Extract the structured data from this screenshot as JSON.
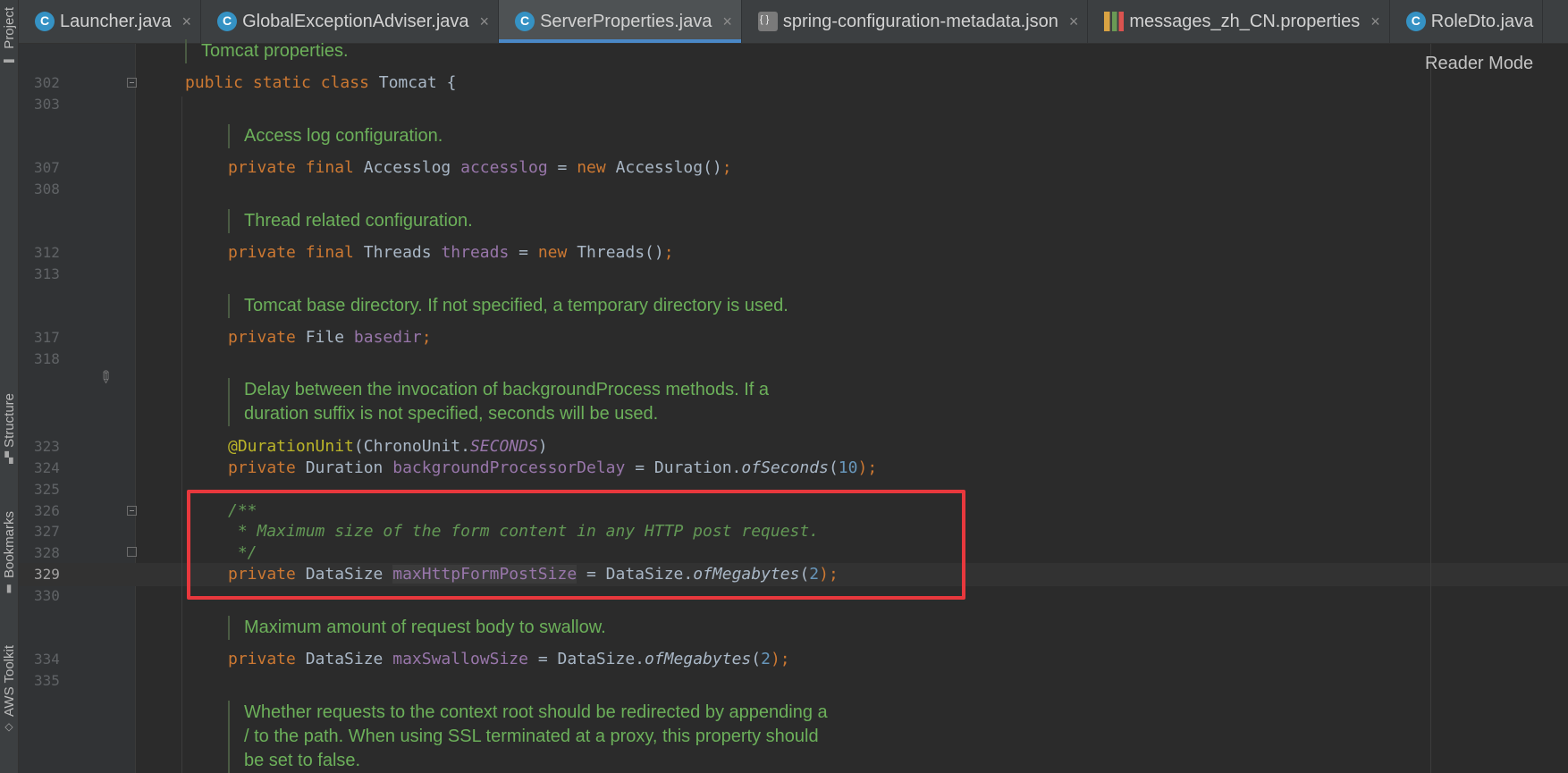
{
  "sidebar": {
    "project_label": "Project",
    "structure_label": "Structure",
    "bookmarks_label": "Bookmarks",
    "aws_label": "AWS Toolkit"
  },
  "tabs": [
    {
      "label": "Launcher.java",
      "icon": "class-icon",
      "active": false
    },
    {
      "label": "GlobalExceptionAdviser.java",
      "icon": "class-icon",
      "active": false
    },
    {
      "label": "ServerProperties.java",
      "icon": "class-icon",
      "active": true
    },
    {
      "label": "spring-configuration-metadata.json",
      "icon": "json-icon",
      "active": false
    },
    {
      "label": "messages_zh_CN.properties",
      "icon": "properties-icon",
      "active": false
    },
    {
      "label": "RoleDto.java",
      "icon": "class-icon",
      "active": false
    }
  ],
  "editor": {
    "reader_mode": "Reader Mode",
    "top_doc": "Tomcat properties.",
    "line_numbers": [
      "302",
      "303",
      "307",
      "308",
      "312",
      "313",
      "317",
      "318",
      "323",
      "324",
      "325",
      "326",
      "327",
      "328",
      "329",
      "330",
      "334",
      "335"
    ],
    "code": {
      "l302": {
        "kw": "public static class",
        "name": "Tomcat",
        "brace": "{"
      },
      "doc_accesslog": "Access log configuration.",
      "l307": {
        "kw": "private final",
        "type": "Accesslog",
        "field": "accesslog",
        "eq": "=",
        "new": "new",
        "ctor": "Accesslog()",
        "semi": ";"
      },
      "doc_threads": "Thread related configuration.",
      "l312": {
        "kw": "private final",
        "type": "Threads",
        "field": "threads",
        "eq": "=",
        "new": "new",
        "ctor": "Threads()",
        "semi": ";"
      },
      "doc_basedir": "Tomcat base directory. If not specified, a temporary directory is used.",
      "l317": {
        "kw": "private",
        "type": "File",
        "field": "basedir",
        "semi": ";"
      },
      "doc_delay_1": "Delay between the invocation of backgroundProcess methods. If a",
      "doc_delay_2": "duration suffix is not specified, seconds will be used.",
      "l323": {
        "ann": "@DurationUnit",
        "open": "(ChronoUnit.",
        "const": "SECONDS",
        "close": ")"
      },
      "l324": {
        "kw": "private",
        "type": "Duration",
        "field": "backgroundProcessorDelay",
        "eq": "= Duration.",
        "method": "ofSeconds",
        "open": "(",
        "num": "10",
        "close": ");"
      },
      "l326": "/**",
      "l327": " * Maximum size of the form content in any HTTP post request.",
      "l328": " */",
      "l329": {
        "kw": "private",
        "type": "DataSize",
        "field": "maxHttpFormPostSize",
        "eq": "= DataSize.",
        "method": "ofMegabytes",
        "open": "(",
        "num": "2",
        "close": ");"
      },
      "doc_swallow": "Maximum amount of request body to swallow.",
      "l334": {
        "kw": "private",
        "type": "DataSize",
        "field": "maxSwallowSize",
        "eq": "= DataSize.",
        "method": "ofMegabytes",
        "open": "(",
        "num": "2",
        "close": ");"
      },
      "doc_redirect_1": "Whether requests to the context root should be redirected by appending a",
      "doc_redirect_2": "/ to the path. When using SSL terminated at a proxy, this property should",
      "doc_redirect_3": "be set to false."
    }
  },
  "colors": {
    "highlight_box": "#e8383d",
    "active_tab_underline": "#4a88c7"
  }
}
